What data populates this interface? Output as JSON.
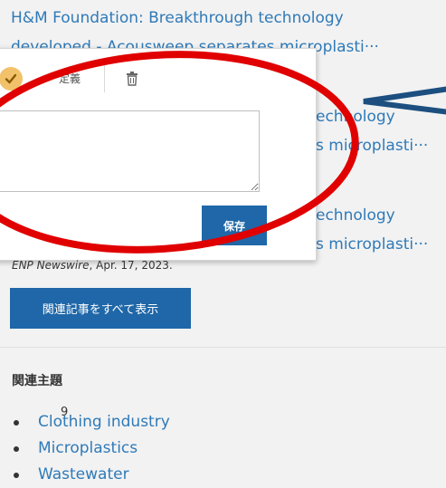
{
  "articles": [
    {
      "line1": "H&M Foundation: Breakthrough technology",
      "line2": "developed - Acousweep separates microplasti···"
    },
    {
      "line1": "echnology",
      "line2": "s microplasti···"
    },
    {
      "line1": "echnology",
      "line2": "s microplasti···"
    }
  ],
  "note_panel": {
    "define_label": "定義",
    "textarea_value": "",
    "save_label": "保存",
    "icons": [
      "check-icon",
      "trash-icon"
    ]
  },
  "source": {
    "publication": "ENP Newswire",
    "date": ", Apr. 17, 2023."
  },
  "view_all_label": "関連記事をすべて表示",
  "related_topics": {
    "heading": "関連主題",
    "items": [
      "Clothing industry",
      "Microplastics",
      "Wastewater"
    ]
  },
  "page_number": "9",
  "colors": {
    "link": "#2f7ab8",
    "button": "#1f67a8",
    "annotation_red": "#e00000",
    "annotation_arrow": "#1c4f80",
    "check_badge": "#f2c26a"
  }
}
